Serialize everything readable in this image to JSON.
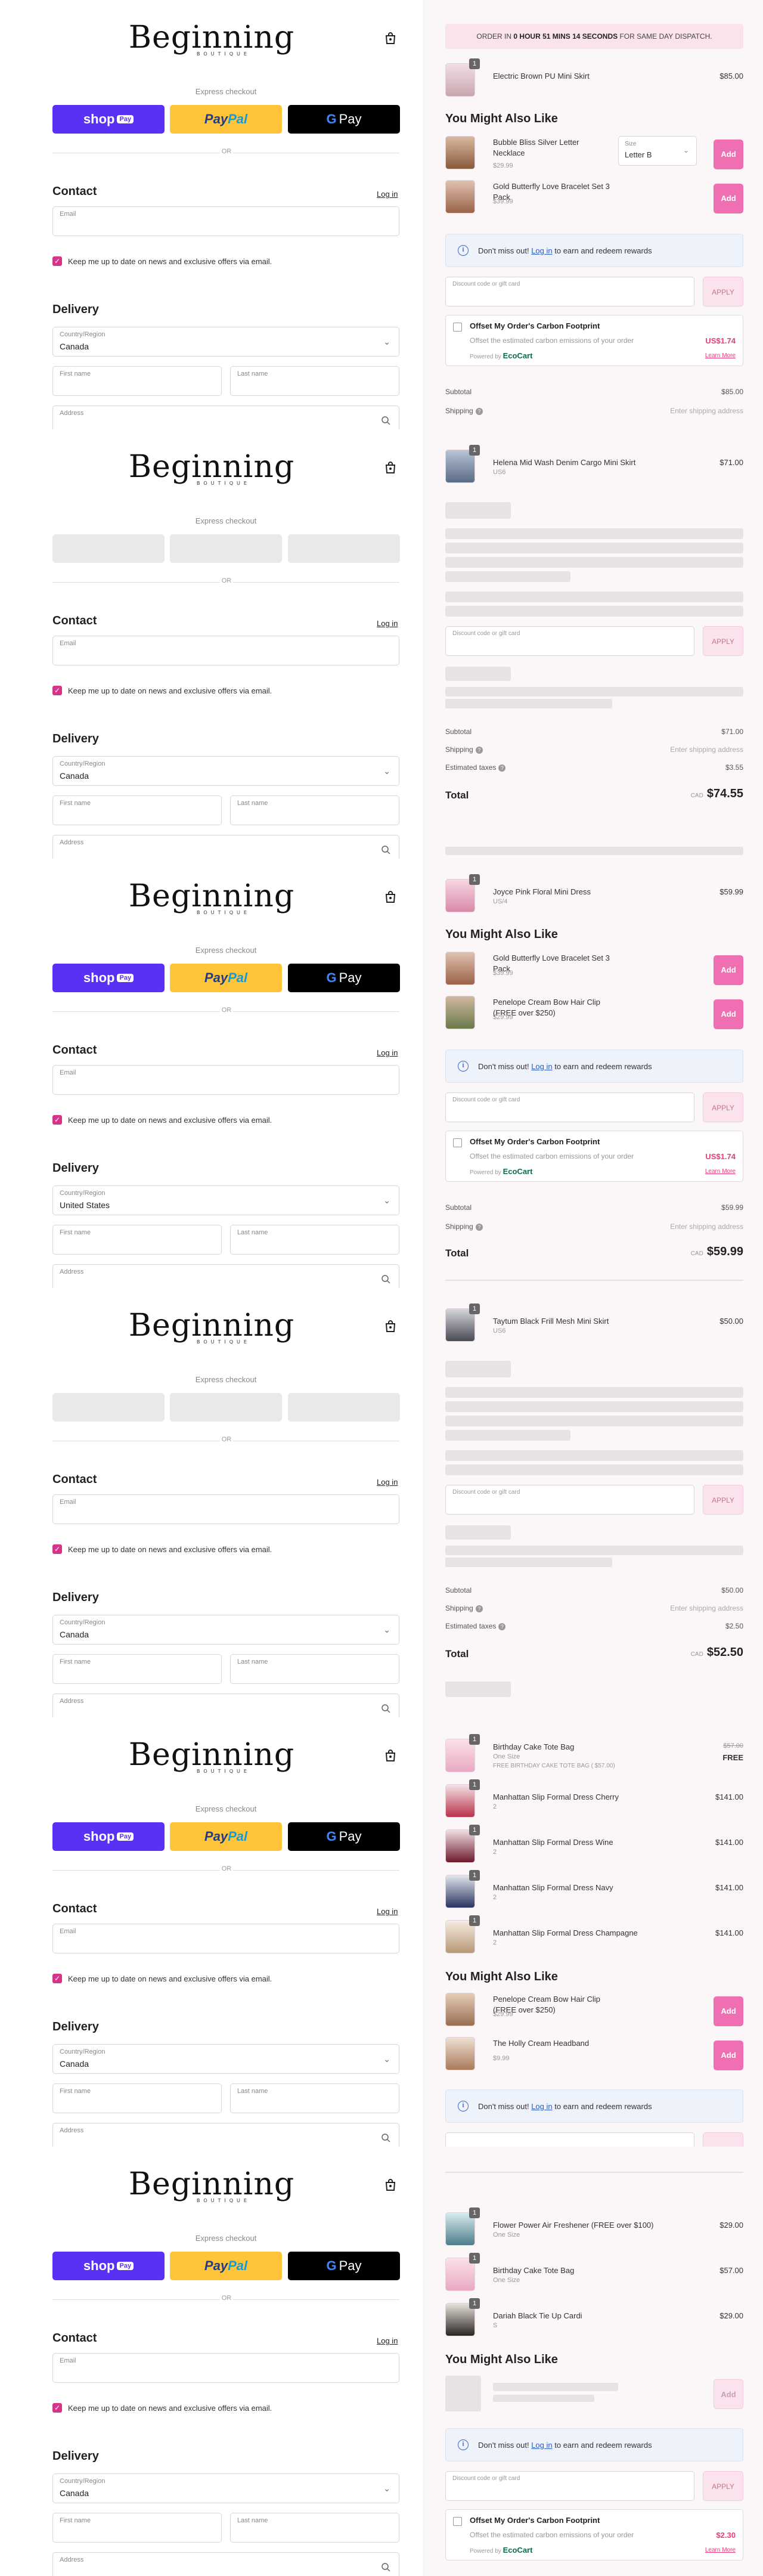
{
  "brand": {
    "logo": "Beginning",
    "logo_sub": "BOUTIQUE"
  },
  "checkout": {
    "express": "Express checkout",
    "shop_pay": "shop",
    "shop_pay_pill": "Pay",
    "paypal_a": "Pay",
    "paypal_b": "Pal",
    "gpay_g": "G",
    "gpay_text": "Pay",
    "or": "OR",
    "contact": "Contact",
    "login": "Log in",
    "email_label": "Email",
    "news_label": "Keep me up to date on news and exclusive offers via email.",
    "delivery": "Delivery",
    "country_label": "Country/Region",
    "first_name": "First name",
    "last_name": "Last name",
    "address": "Address"
  },
  "countries": [
    "Canada",
    "Canada",
    "United States",
    "Canada",
    "Canada",
    "Canada"
  ],
  "timer": {
    "pre": "ORDER IN",
    "bold": "0 HOUR 51 MINS 14 SECONDS",
    "post": "FOR SAME DAY DISPATCH."
  },
  "ui": {
    "might": "You Might Also Like",
    "add": "Add",
    "size_label": "Size",
    "size_value": "Letter B",
    "rewards_pre": "Don't miss out!",
    "rewards_link": "Log in",
    "rewards_post": "to earn and redeem rewards",
    "discount": "Discount code or gift card",
    "apply": "APPLY",
    "carbon_title": "Offset My Order's Carbon Footprint",
    "carbon_desc": "Offset the estimated carbon emissions of your order",
    "powered": "Powered by",
    "ecocart": "EcoCart",
    "learn": "Learn More",
    "subtotal": "Subtotal",
    "shipping": "Shipping",
    "ship_value": "Enter shipping address",
    "taxes": "Estimated taxes",
    "total": "Total",
    "cad": "CAD",
    "free": "FREE",
    "free_note": "FREE BIRTHDAY CAKE TOTE BAG ( $57.00)"
  },
  "panels": [
    {
      "items": [
        {
          "name": "Electric Brown PU Mini Skirt",
          "sub": "",
          "price": "$85.00",
          "qty": "1"
        }
      ],
      "recs": [
        {
          "name": "Bubble Bliss Silver Letter Necklace",
          "price": "$29.99"
        },
        {
          "name": "Gold Butterfly Love Bracelet Set 3 Pack",
          "price": "$39.99"
        }
      ],
      "carbon_price": "US$1.74",
      "subtotal": "$85.00"
    },
    {
      "items": [
        {
          "name": "Helena Mid Wash Denim Cargo Mini Skirt",
          "sub": "US6",
          "price": "$71.00",
          "qty": "1"
        }
      ],
      "subtotal": "$71.00",
      "taxes": "$3.55",
      "total": "$74.55"
    },
    {
      "items": [
        {
          "name": "Joyce Pink Floral Mini Dress",
          "sub": "US/4",
          "price": "$59.99",
          "qty": "1"
        }
      ],
      "recs": [
        {
          "name": "Gold Butterfly Love Bracelet Set 3 Pack",
          "price": "$39.99"
        },
        {
          "name": "Penelope Cream Bow Hair Clip (FREE over $250)",
          "price": "$29.99"
        }
      ],
      "carbon_price": "US$1.74",
      "subtotal": "$59.99",
      "total": "$59.99"
    },
    {
      "items": [
        {
          "name": "Taytum Black Frill Mesh Mini Skirt",
          "sub": "US6",
          "price": "$50.00",
          "qty": "1"
        }
      ],
      "subtotal": "$50.00",
      "taxes": "$2.50",
      "total": "$52.50"
    },
    {
      "items": [
        {
          "name": "Birthday Cake Tote Bag",
          "sub": "One Size",
          "price": "$57.00",
          "price2": "FREE",
          "qty": "1"
        },
        {
          "name": "Manhattan Slip Formal Dress Cherry",
          "sub": "2",
          "price": "$141.00",
          "qty": "1"
        },
        {
          "name": "Manhattan Slip Formal Dress Wine",
          "sub": "2",
          "price": "$141.00",
          "qty": "1"
        },
        {
          "name": "Manhattan Slip Formal Dress Navy",
          "sub": "2",
          "price": "$141.00",
          "qty": "1"
        },
        {
          "name": "Manhattan Slip Formal Dress Champagne",
          "sub": "2",
          "price": "$141.00",
          "qty": "1"
        }
      ],
      "recs": [
        {
          "name": "Penelope Cream Bow Hair Clip (FREE over $250)",
          "price": "$29.99"
        },
        {
          "name": "The Holly Cream Headband",
          "price": "$9.99"
        }
      ]
    },
    {
      "items": [
        {
          "name": "Flower Power Air Freshener (FREE over $100)",
          "sub": "One Size",
          "price": "$29.00",
          "qty": "1"
        },
        {
          "name": "Birthday Cake Tote Bag",
          "sub": "One Size",
          "price": "$57.00",
          "qty": "1"
        },
        {
          "name": "Dariah Black Tie Up Cardi",
          "sub": "S",
          "price": "$29.00",
          "qty": "1"
        }
      ],
      "carbon_price": "$2.30"
    }
  ],
  "colors": {
    "accent": "#d6338a",
    "add_button": "#f06fb3",
    "shop_pay": "#5a31f4",
    "paypal": "#ffc439"
  }
}
